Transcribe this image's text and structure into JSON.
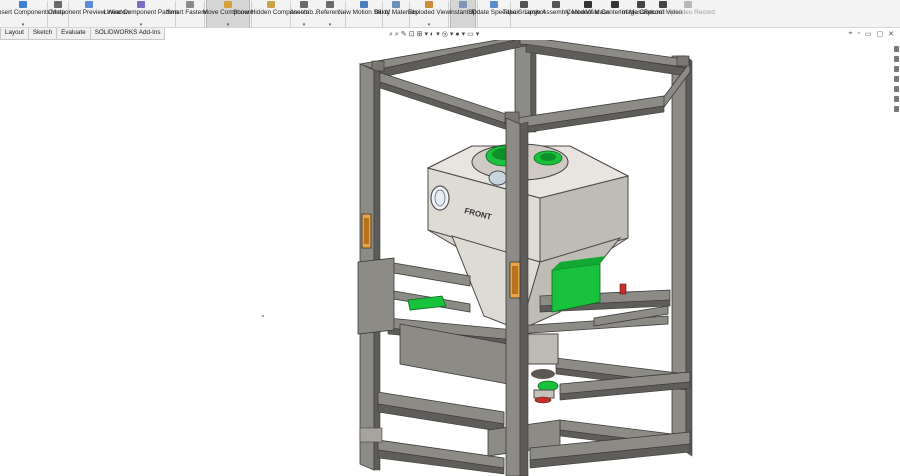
{
  "ribbon": [
    {
      "id": "insert-components",
      "label": "Insert Components",
      "dd": "▾",
      "color": "#3f7fd0",
      "icon": "insert-components-icon"
    },
    {
      "id": "mate",
      "label": "Mate",
      "dd": "",
      "color": "#6b6b6b",
      "icon": "mate-icon"
    },
    {
      "id": "component-preview",
      "label": "Component Preview Window",
      "dd": "",
      "color": "#5a8ad8",
      "icon": "component-preview-icon"
    },
    {
      "id": "linear-component-pattern",
      "label": "Linear Component Pattern",
      "dd": "▾",
      "color": "#7a6fc4",
      "icon": "linear-pattern-icon"
    },
    {
      "id": "smart-fasteners",
      "label": "Smart Fasteners",
      "dd": "",
      "color": "#8a8a8a",
      "icon": "smart-fasteners-icon"
    },
    {
      "id": "move-component",
      "label": "Move Component",
      "dd": "▾",
      "color": "#d3a03b",
      "icon": "move-component-icon"
    },
    {
      "id": "show-hidden-components",
      "label": "Show Hidden Components",
      "dd": "",
      "color": "#c9a54a",
      "icon": "show-hidden-icon"
    },
    {
      "id": "assembly-features",
      "label": "Assemb...",
      "dd": "▾",
      "color": "#6b6b6b",
      "icon": "assembly-features-icon"
    },
    {
      "id": "reference-geometry",
      "label": "Referen...",
      "dd": "▾",
      "color": "#6b6b6b",
      "icon": "reference-geometry-icon"
    },
    {
      "id": "new-motion-study",
      "label": "New Motion Study",
      "dd": "",
      "color": "#4a7fc0",
      "icon": "motion-study-icon"
    },
    {
      "id": "bill-of-materials",
      "label": "Bill of Materials",
      "dd": "",
      "color": "#6b8fb5",
      "icon": "bom-icon"
    },
    {
      "id": "exploded-view",
      "label": "Exploded View",
      "dd": "▾",
      "color": "#d08a3c",
      "icon": "exploded-view-icon"
    },
    {
      "id": "instant3d",
      "label": "Instant3D",
      "dd": "",
      "color": "#7b96b8",
      "icon": "instant3d-icon"
    },
    {
      "id": "update-speedpak",
      "label": "Update Speedpak",
      "dd": "",
      "color": "#5c8bd0",
      "icon": "speedpak-icon"
    },
    {
      "id": "take-snapshot",
      "label": "Take Snapshot",
      "dd": "",
      "color": "#555555",
      "icon": "camera-icon"
    },
    {
      "id": "large-assembly-mode",
      "label": "Large Assembly Mode",
      "dd": "",
      "color": "#555555",
      "icon": "large-assembly-icon"
    },
    {
      "id": "center-of-mass",
      "label": "Center of Mass",
      "dd": "",
      "color": "#333333",
      "icon": "center-of-mass-icon"
    },
    {
      "id": "view-center-of-mass",
      "label": "View Center of Mass",
      "dd": "",
      "color": "#333333",
      "icon": "view-center-of-mass-icon"
    },
    {
      "id": "image-capture",
      "label": "Image Capture",
      "dd": "",
      "color": "#444444",
      "icon": "image-capture-icon"
    },
    {
      "id": "record-video",
      "label": "Record Video",
      "dd": "",
      "color": "#444444",
      "icon": "record-video-icon"
    },
    {
      "id": "stop-video-record",
      "label": "Stop Video Record",
      "dd": "",
      "color": "#b8b8b8",
      "icon": "stop-record-icon"
    }
  ],
  "tabs": [
    "Layout",
    "Sketch",
    "Evaluate",
    "SOLIDWORKS Add-Ins"
  ],
  "hud_icons": [
    "⌕",
    "⌕",
    "✎",
    "⊡",
    "⊞",
    "▾",
    "◐",
    "▾",
    "◎",
    "▾",
    "●",
    "▾",
    "▭",
    "▾"
  ],
  "window_controls": [
    "⌖",
    "▫",
    "▭",
    "▢",
    "✕"
  ],
  "model": {
    "label": "FRONT",
    "frame_color": "#8d8b86",
    "frame_dark": "#5f5d59",
    "hopper_color": "#d6d2cc",
    "accent_green": "#19c23c",
    "accent_red": "#c2302a"
  }
}
